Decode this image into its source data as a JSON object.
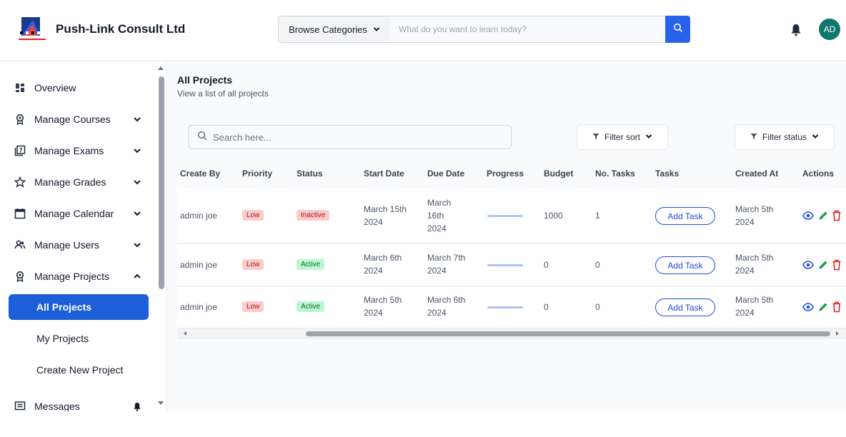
{
  "header": {
    "brand": "Push-Link Consult Ltd",
    "browse_label": "Browse Categories",
    "search_placeholder": "What do you want to learn today?",
    "avatar_initials": "AD"
  },
  "sidebar": {
    "items": [
      {
        "label": "Overview",
        "icon": "grid-icon"
      },
      {
        "label": "Manage Courses",
        "icon": "award-icon"
      },
      {
        "label": "Manage Exams",
        "icon": "exam-icon"
      },
      {
        "label": "Manage Grades",
        "icon": "star-icon"
      },
      {
        "label": "Manage Calendar",
        "icon": "calendar-icon"
      },
      {
        "label": "Manage Users",
        "icon": "users-icon"
      },
      {
        "label": "Manage Projects",
        "icon": "award-icon"
      }
    ],
    "sub_items": [
      "All Projects",
      "My Projects",
      "Create New Project"
    ],
    "messages_label": "Messages"
  },
  "main": {
    "title": "All Projects",
    "subtitle": "View a list of all projects",
    "search_placeholder": "Search here...",
    "filter_sort_label": "Filter sort",
    "filter_status_label": "Filter status",
    "columns": [
      "Create By",
      "Priority",
      "Status",
      "Start Date",
      "Due Date",
      "Progress",
      "Budget",
      "No. Tasks",
      "Tasks",
      "Created At",
      "Actions"
    ],
    "add_task_label": "Add Task",
    "rows": [
      {
        "created_by": "admin joe",
        "priority": "Low",
        "status": "Inactive",
        "start_date": "March 15th 2024",
        "due_date": "March 16th 2024",
        "progress": 0,
        "budget": "1000",
        "tasks": "1",
        "created_at": "March 5th 2024"
      },
      {
        "created_by": "admin joe",
        "priority": "Low",
        "status": "Active",
        "start_date": "March 6th 2024",
        "due_date": "March 7th 2024",
        "progress": 0,
        "budget": "0",
        "tasks": "0",
        "created_at": "March 5th 2024"
      },
      {
        "created_by": "admin joe",
        "priority": "Low",
        "status": "Active",
        "start_date": "March 5th 2024",
        "due_date": "March 6th 2024",
        "progress": 0,
        "budget": "0",
        "tasks": "0",
        "created_at": "March 5th 2024"
      }
    ]
  },
  "colors": {
    "primary": "#1d5fd8",
    "search_button": "#2563eb",
    "avatar": "#0f766e",
    "eye_action": "#1d4ed8",
    "edit_action": "#16a34a",
    "delete_action": "#dc2626"
  }
}
